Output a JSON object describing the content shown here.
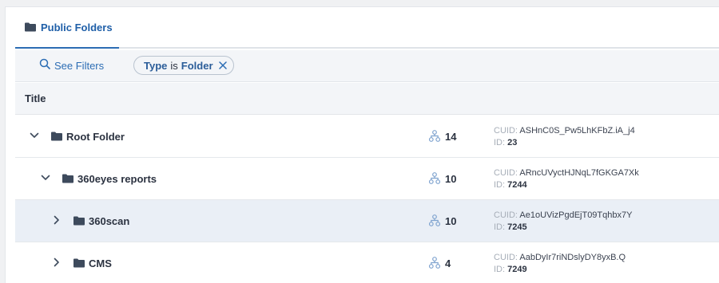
{
  "tabs": [
    {
      "label": "Public Folders",
      "icon": "folder-icon"
    }
  ],
  "filters": {
    "see_filters_label": "See Filters",
    "chip": {
      "field": "Type",
      "operator": "is",
      "value": "Folder"
    }
  },
  "table": {
    "column_title": "Title",
    "rows": [
      {
        "name": "Root Folder",
        "expanded": true,
        "count": "14",
        "cuid_label": "CUID:",
        "cuid": "ASHnC0S_Pw5LhKFbZ.iA_j4",
        "id_label": "ID:",
        "id": "23"
      },
      {
        "name": "360eyes reports",
        "expanded": true,
        "count": "10",
        "cuid_label": "CUID:",
        "cuid": "ARncUVyctHJNqL7fGKGA7Xk",
        "id_label": "ID:",
        "id": "7244"
      },
      {
        "name": "360scan",
        "expanded": false,
        "count": "10",
        "cuid_label": "CUID:",
        "cuid": "Ae1oUVizPgdEjT09Tqhbx7Y",
        "id_label": "ID:",
        "id": "7245"
      },
      {
        "name": "CMS",
        "expanded": false,
        "count": "4",
        "cuid_label": "CUID:",
        "cuid": "AabDyIr7riNDslyDY8yxB.Q",
        "id_label": "ID:",
        "id": "7249"
      }
    ]
  },
  "colors": {
    "accent": "#2c6db4",
    "folder": "#3d4a5c",
    "selected_row": "#eaeff6",
    "hierarchy_icon": "#7fa3cf"
  }
}
